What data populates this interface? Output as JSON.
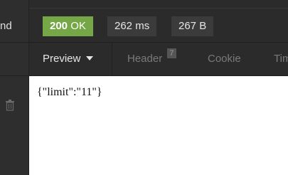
{
  "sidebar": {
    "truncated_label": "nd",
    "delete_icon": "trash-icon"
  },
  "status": {
    "code": "200",
    "text": "OK",
    "code_color": "#76a746",
    "time": "262 ms",
    "size": "267 B"
  },
  "tabs": {
    "preview": "Preview",
    "header": "Header",
    "header_count": "7",
    "cookie": "Cookie",
    "timeline": "Tim"
  },
  "response": {
    "body": "{\"limit\":\"11\"}"
  }
}
